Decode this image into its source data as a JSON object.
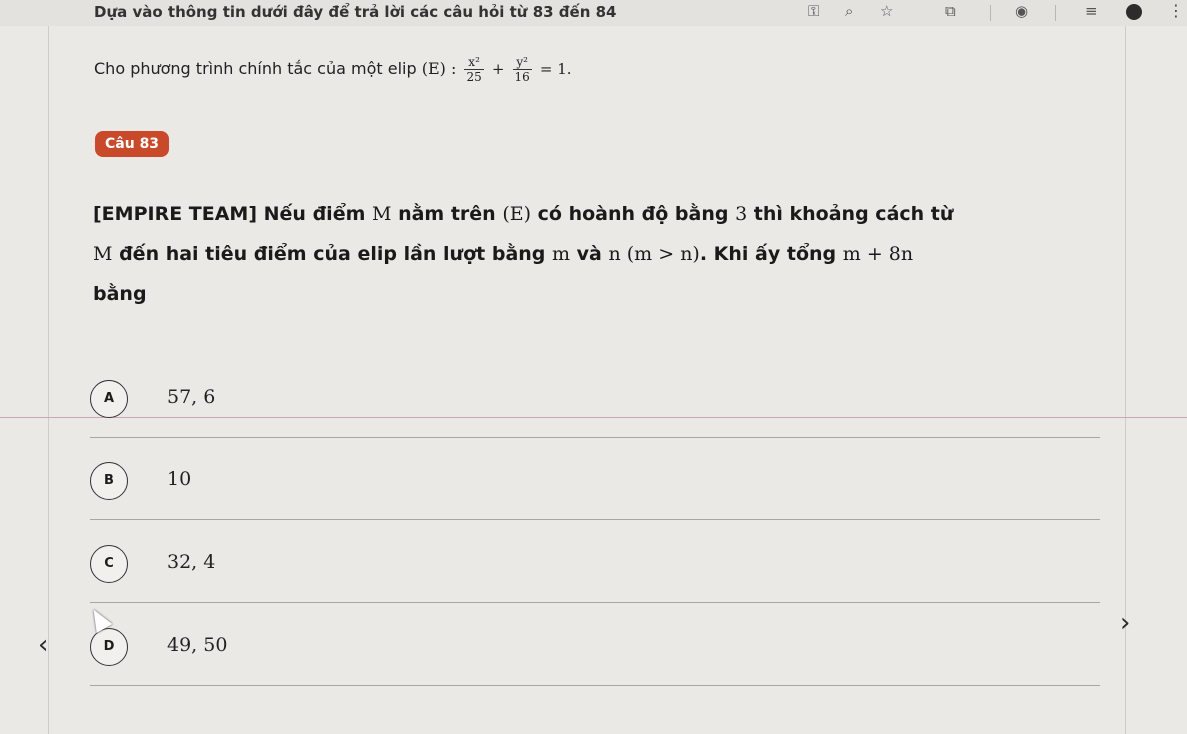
{
  "intro": "Dựa vào thông tin dưới đây để trả lời các câu hỏi từ 83 đến 84",
  "given": {
    "text": "Cho phương trình chính tắc của một elip",
    "ellipse": "(E) :",
    "frac1_num": "x²",
    "frac1_den": "25",
    "plus": "+",
    "frac2_num": "y²",
    "frac2_den": "16",
    "tail": "= 1."
  },
  "badge": "Câu 83",
  "question": {
    "tag": "[EMPIRE TEAM]",
    "p1": " Nếu điểm ",
    "M": "M",
    "p2": " nằm trên ",
    "E": "(E)",
    "p3": " có hoành độ bằng ",
    "three": "3",
    "p4": " thì khoảng cách từ ",
    "M2": "M",
    "p5": " đến hai tiêu điểm của elip lần lượt bằng ",
    "m": "m",
    "p6": " và ",
    "n": "n (m > n)",
    "p7": ". Khi ấy tổng ",
    "expr": "m + 8n",
    "p8": " bằng"
  },
  "options": [
    {
      "letter": "A",
      "value": "57, 6"
    },
    {
      "letter": "B",
      "value": "10"
    },
    {
      "letter": "C",
      "value": "32, 4"
    },
    {
      "letter": "D",
      "value": "49, 50"
    }
  ],
  "nav": {
    "prev": "‹",
    "next": "›"
  },
  "colors": {
    "badge": "#c94a2a",
    "background": "#ebe9e6"
  }
}
